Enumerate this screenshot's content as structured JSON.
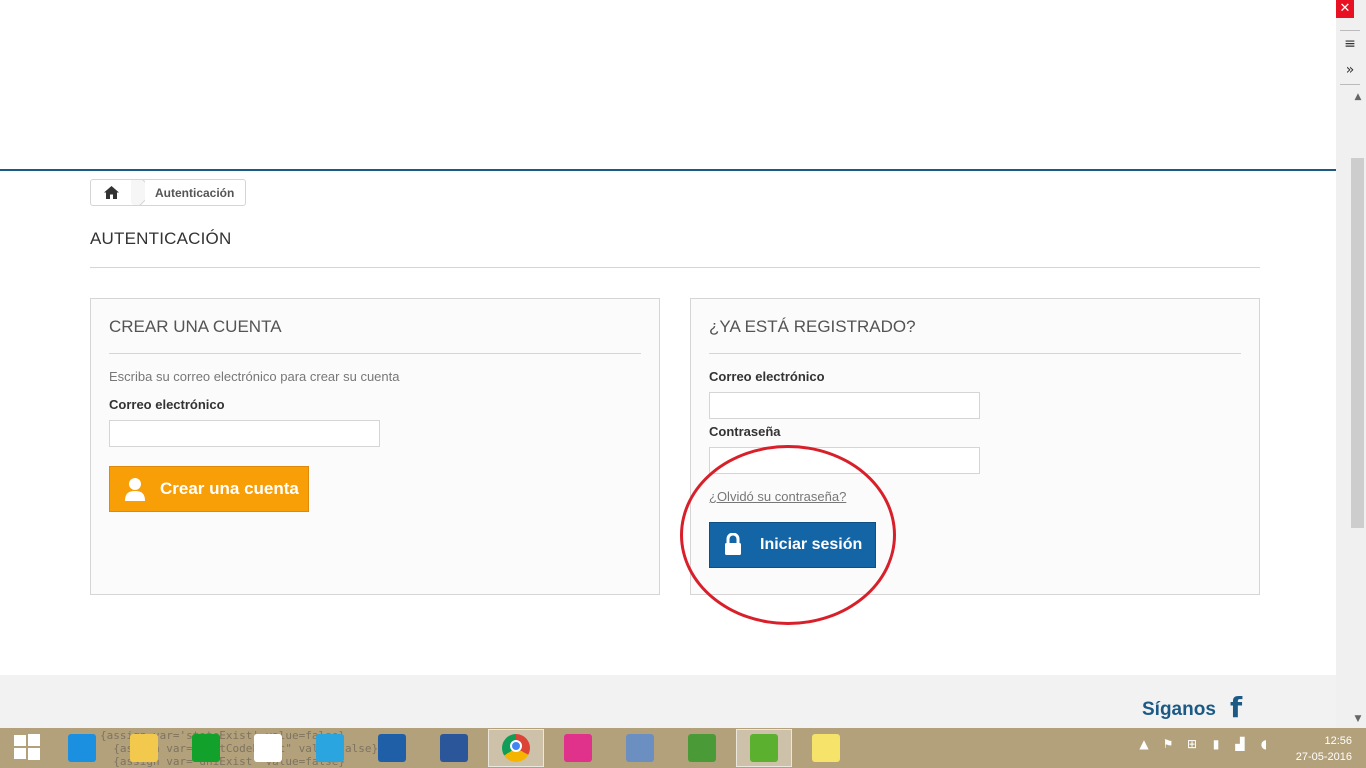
{
  "breadcrumb": {
    "home_icon": "home-icon",
    "current": "Autenticación"
  },
  "page": {
    "heading": "AUTENTICACIÓN"
  },
  "create_account": {
    "title": "CREAR UNA CUENTA",
    "instruction": "Escriba su correo electrónico para crear su cuenta",
    "email_label": "Correo electrónico",
    "email_value": "",
    "button_label": "Crear una cuenta",
    "button_icon": "user-icon"
  },
  "login": {
    "title": "¿YA ESTÁ REGISTRADO?",
    "email_label": "Correo electrónico",
    "email_value": "",
    "password_label": "Contraseña",
    "password_value": "",
    "forgot_link": "¿Olvidó su contraseña?",
    "button_label": "Iniciar sesión",
    "button_icon": "lock-icon"
  },
  "footer": {
    "follow_label": "Síganos",
    "social_icon": "facebook-icon"
  },
  "browser_side": {
    "close": "✕",
    "menu": "≡",
    "more": "»"
  },
  "taskbar": {
    "ghost_code": "{assign var='stateExist' value=false}\n  {assign var=\"postCodeExist\" value=false}\n  {assign var=\"dniExist\" value=false}",
    "clock_time": "12:56",
    "clock_date": "27-05-2016",
    "items": [
      {
        "name": "start-icon",
        "color": "#ffffff"
      },
      {
        "name": "internet-explorer-icon",
        "color": "#1b8fe0"
      },
      {
        "name": "file-explorer-icon",
        "color": "#f2c94c"
      },
      {
        "name": "store-icon",
        "color": "#12a12a"
      },
      {
        "name": "home-group-icon",
        "color": "#ffffff"
      },
      {
        "name": "shopping-icon",
        "color": "#2aa5e0"
      },
      {
        "name": "lenovo-icon",
        "color": "#1e5fa8"
      },
      {
        "name": "word-icon",
        "color": "#2b579a"
      },
      {
        "name": "chrome-icon",
        "color": "#db4437"
      },
      {
        "name": "wamp-icon",
        "color": "#e0328b"
      },
      {
        "name": "network-monitor-icon",
        "color": "#6a8fc0"
      },
      {
        "name": "notepad-plus-icon",
        "color": "#4a9b38"
      },
      {
        "name": "utorrent-icon",
        "color": "#5cb02f"
      },
      {
        "name": "sticky-notes-icon",
        "color": "#f5e36a"
      }
    ]
  }
}
